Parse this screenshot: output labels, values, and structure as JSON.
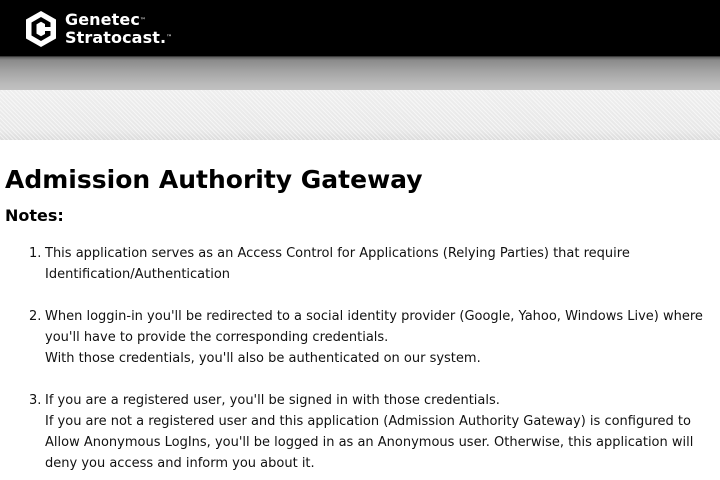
{
  "header": {
    "brand_line1": "Genetec",
    "brand_line2": "Stratocast."
  },
  "main": {
    "title": "Admission Authority Gateway",
    "notes_label": "Notes:",
    "notes": [
      {
        "number": "1.",
        "lines": [
          "This application serves as an Access Control for Applications (Relying Parties) that require",
          "Identification/Authentication"
        ]
      },
      {
        "number": "2.",
        "lines": [
          "When loggin-in you'll be redirected to a social identity provider (Google, Yahoo, Windows Live) where",
          "you'll have to provide the corresponding credentials.",
          "With those credentials, you'll also be authenticated on our system."
        ]
      },
      {
        "number": "3.",
        "lines": [
          "If you are a registered user, you'll be signed in with those credentials.",
          "If you are not a registered user and this application (Admission Authority Gateway) is configured to",
          "Allow Anonymous LogIns, you'll be logged in as an Anonymous user. Otherwise, this application will",
          "deny you access and inform you about it."
        ]
      }
    ]
  }
}
